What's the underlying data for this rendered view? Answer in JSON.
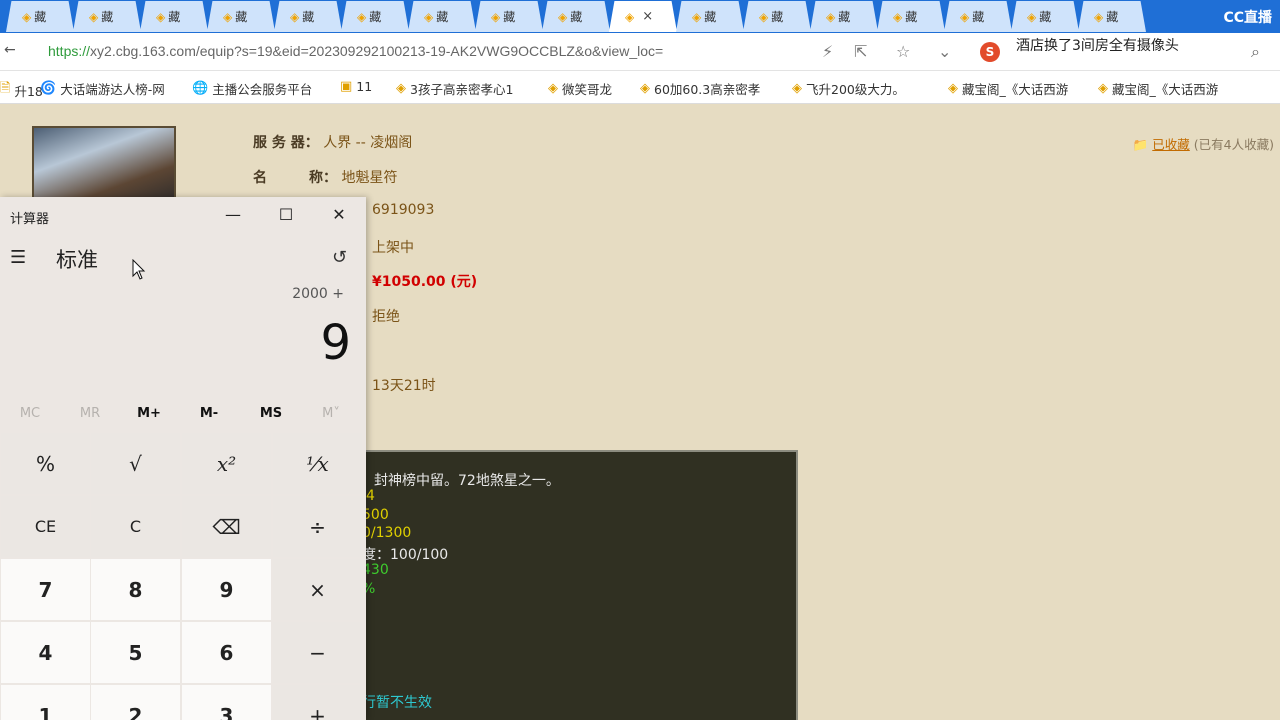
{
  "tabs": {
    "items": [
      {
        "label": "藏",
        "active": false
      },
      {
        "label": "藏",
        "active": false
      },
      {
        "label": "藏",
        "active": false
      },
      {
        "label": "藏",
        "active": false
      },
      {
        "label": "藏",
        "active": false
      },
      {
        "label": "藏",
        "active": false
      },
      {
        "label": "藏",
        "active": false
      },
      {
        "label": "藏",
        "active": false
      },
      {
        "label": "藏",
        "active": false
      },
      {
        "label": "",
        "active": true
      },
      {
        "label": "藏",
        "active": false
      },
      {
        "label": "藏",
        "active": false
      },
      {
        "label": "藏",
        "active": false
      },
      {
        "label": "藏",
        "active": false
      },
      {
        "label": "藏",
        "active": false
      },
      {
        "label": "藏",
        "active": false
      },
      {
        "label": "藏",
        "active": false
      }
    ],
    "close_glyph": "×",
    "brand": "CC直播"
  },
  "addressbar": {
    "url_scheme": "https://",
    "url_rest": "xy2.cbg.163.com/equip?s=19&eid=202309292100213-19-AK2VWG9OCCBLZ&o&view_loc=",
    "search_engine_glyph": "S",
    "search_hint": "酒店换了3间房全有摄像头"
  },
  "bookmarks": [
    {
      "label": "升18",
      "icon": "🗎"
    },
    {
      "label": "大话端游达人榜-网",
      "icon": "🌀"
    },
    {
      "label": "主播公会服务平台",
      "icon": "🌐"
    },
    {
      "label": "11",
      "icon": "▣"
    },
    {
      "label": "3孩子高亲密孝心1",
      "icon": "◈"
    },
    {
      "label": "微笑哥龙",
      "icon": "◈"
    },
    {
      "label": "60加60.3高亲密孝",
      "icon": "◈"
    },
    {
      "label": "飞升200级大力。",
      "icon": "◈"
    },
    {
      "label": "藏宝阁_《大话西游",
      "icon": "◈"
    },
    {
      "label": "藏宝阁_《大话西游",
      "icon": "◈"
    }
  ],
  "item": {
    "server_label": "服 务 器：",
    "server_value": "人界 -- 凌烟阁",
    "name_label": "名　　　称：",
    "name_value": "地魁星符",
    "id_value": "6919093",
    "status_value": "上架中",
    "price_value": "¥1050.00 (元)",
    "bargain_value": "拒绝",
    "time_left": "13天21时"
  },
  "favorite": {
    "label": "已收藏",
    "count": "(已有4人收藏)"
  },
  "description": {
    "line1": "封神榜中留。72地煞星之一。",
    "line2": "4",
    "line3": "500",
    "line4": "0/1300",
    "line5": "度：100/100",
    "line6": "430",
    "line7": "%",
    "line8": "行暂不生效",
    "colors": {
      "white": "#e8e8e8",
      "yellow": "#e0d000",
      "green": "#3ecc2e",
      "cyan": "#2ec8d0"
    }
  },
  "calculator": {
    "title": "计算器",
    "mode": "标准",
    "expression": "2000 +",
    "display": "9",
    "memory": [
      {
        "label": "MC",
        "enabled": false
      },
      {
        "label": "MR",
        "enabled": false
      },
      {
        "label": "M+",
        "enabled": true
      },
      {
        "label": "M-",
        "enabled": true
      },
      {
        "label": "MS",
        "enabled": true
      },
      {
        "label": "M˅",
        "enabled": false
      }
    ],
    "keys": {
      "percent": "%",
      "sqrt": "√",
      "square": "x²",
      "reciprocal": "⅟x",
      "ce": "CE",
      "clear": "C",
      "backspace": "⌫",
      "divide": "÷",
      "seven": "7",
      "eight": "8",
      "nine": "9",
      "multiply": "×",
      "four": "4",
      "five": "5",
      "six": "6",
      "minus": "−",
      "one": "1",
      "two": "2",
      "three": "3",
      "plus": "+"
    },
    "window_controls": {
      "minimize": "—",
      "maximize": "☐",
      "close": "✕"
    }
  }
}
